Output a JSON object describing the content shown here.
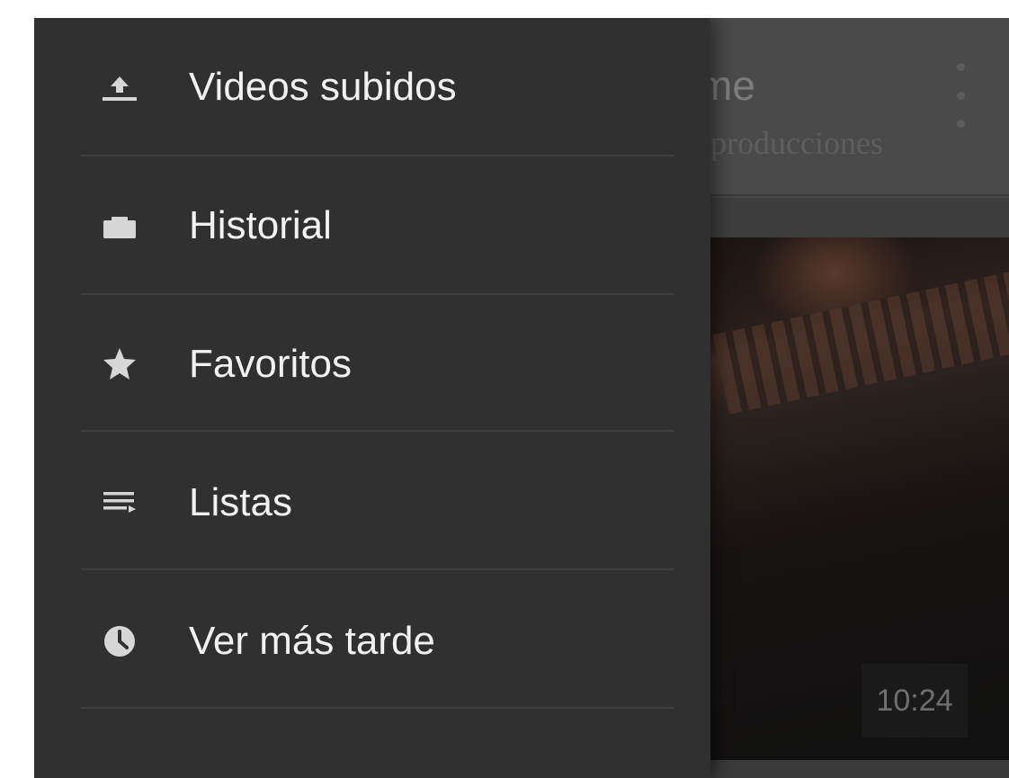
{
  "background": {
    "channel_title_partial": "me",
    "channel_subtitle_partial": "producciones",
    "video_duration": "10:24"
  },
  "drawer": {
    "items": [
      {
        "label": "Videos subidos",
        "icon": "upload-icon"
      },
      {
        "label": "Historial",
        "icon": "history-icon"
      },
      {
        "label": "Favoritos",
        "icon": "star-icon"
      },
      {
        "label": "Listas",
        "icon": "playlist-icon"
      },
      {
        "label": "Ver más tarde",
        "icon": "clock-icon"
      }
    ]
  },
  "colors": {
    "drawer_bg": "#303030",
    "label_text": "#f2f2f2",
    "icon": "#d6d6d6",
    "divider": "#3f3f3f"
  }
}
